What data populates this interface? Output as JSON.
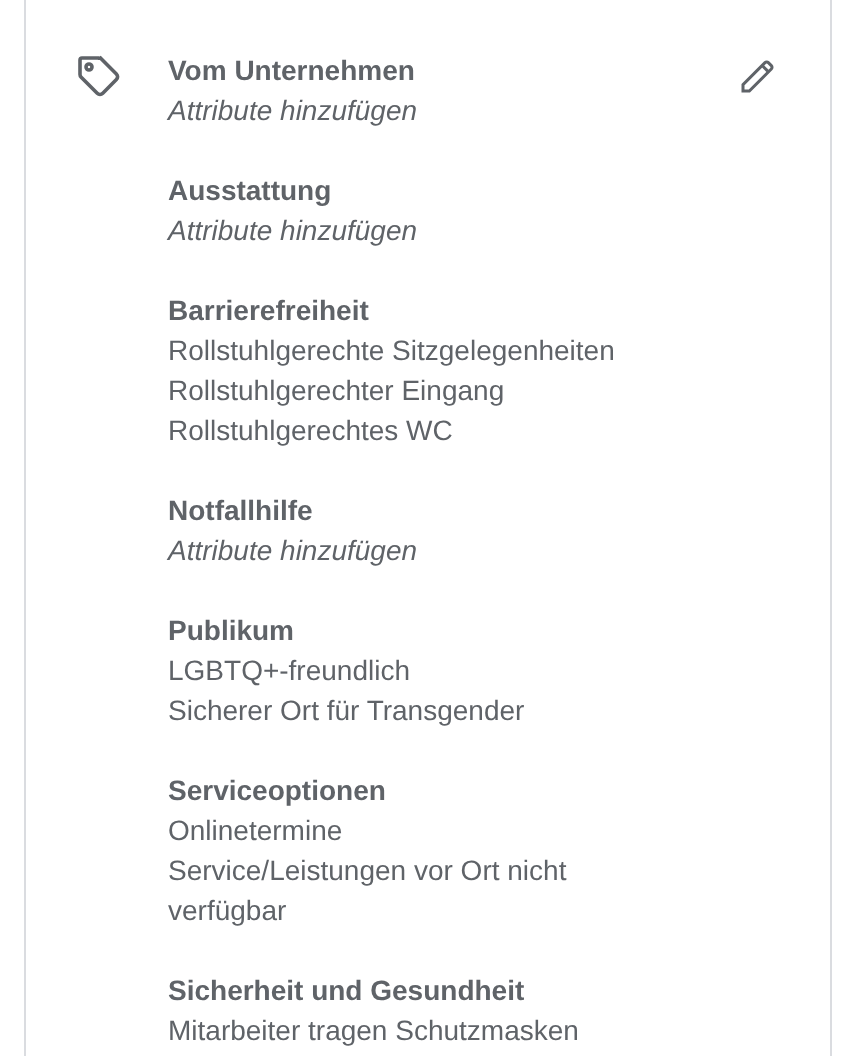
{
  "sections": [
    {
      "title": "Vom Unternehmen",
      "items": [
        {
          "kind": "placeholder",
          "text": "Attribute hinzufügen"
        }
      ]
    },
    {
      "title": "Ausstattung",
      "items": [
        {
          "kind": "placeholder",
          "text": "Attribute hinzufügen"
        }
      ]
    },
    {
      "title": "Barrierefreiheit",
      "items": [
        {
          "kind": "value",
          "text": "Rollstuhlgerechte Sitzgelegenheiten"
        },
        {
          "kind": "value",
          "text": "Rollstuhlgerechter Eingang"
        },
        {
          "kind": "value",
          "text": "Rollstuhlgerechtes WC"
        }
      ]
    },
    {
      "title": "Notfallhilfe",
      "items": [
        {
          "kind": "placeholder",
          "text": "Attribute hinzufügen"
        }
      ]
    },
    {
      "title": "Publikum",
      "items": [
        {
          "kind": "value",
          "text": "LGBTQ+-freundlich"
        },
        {
          "kind": "value",
          "text": "Sicherer Ort für Transgender"
        }
      ]
    },
    {
      "title": "Serviceoptionen",
      "items": [
        {
          "kind": "value",
          "text": "Onlinetermine"
        },
        {
          "kind": "value",
          "text": "Service/Leistungen vor Ort nicht verfügbar"
        }
      ]
    },
    {
      "title": "Sicherheit und Gesundheit",
      "items": [
        {
          "kind": "value",
          "text": "Mitarbeiter tragen Schutzmasken"
        }
      ]
    }
  ]
}
